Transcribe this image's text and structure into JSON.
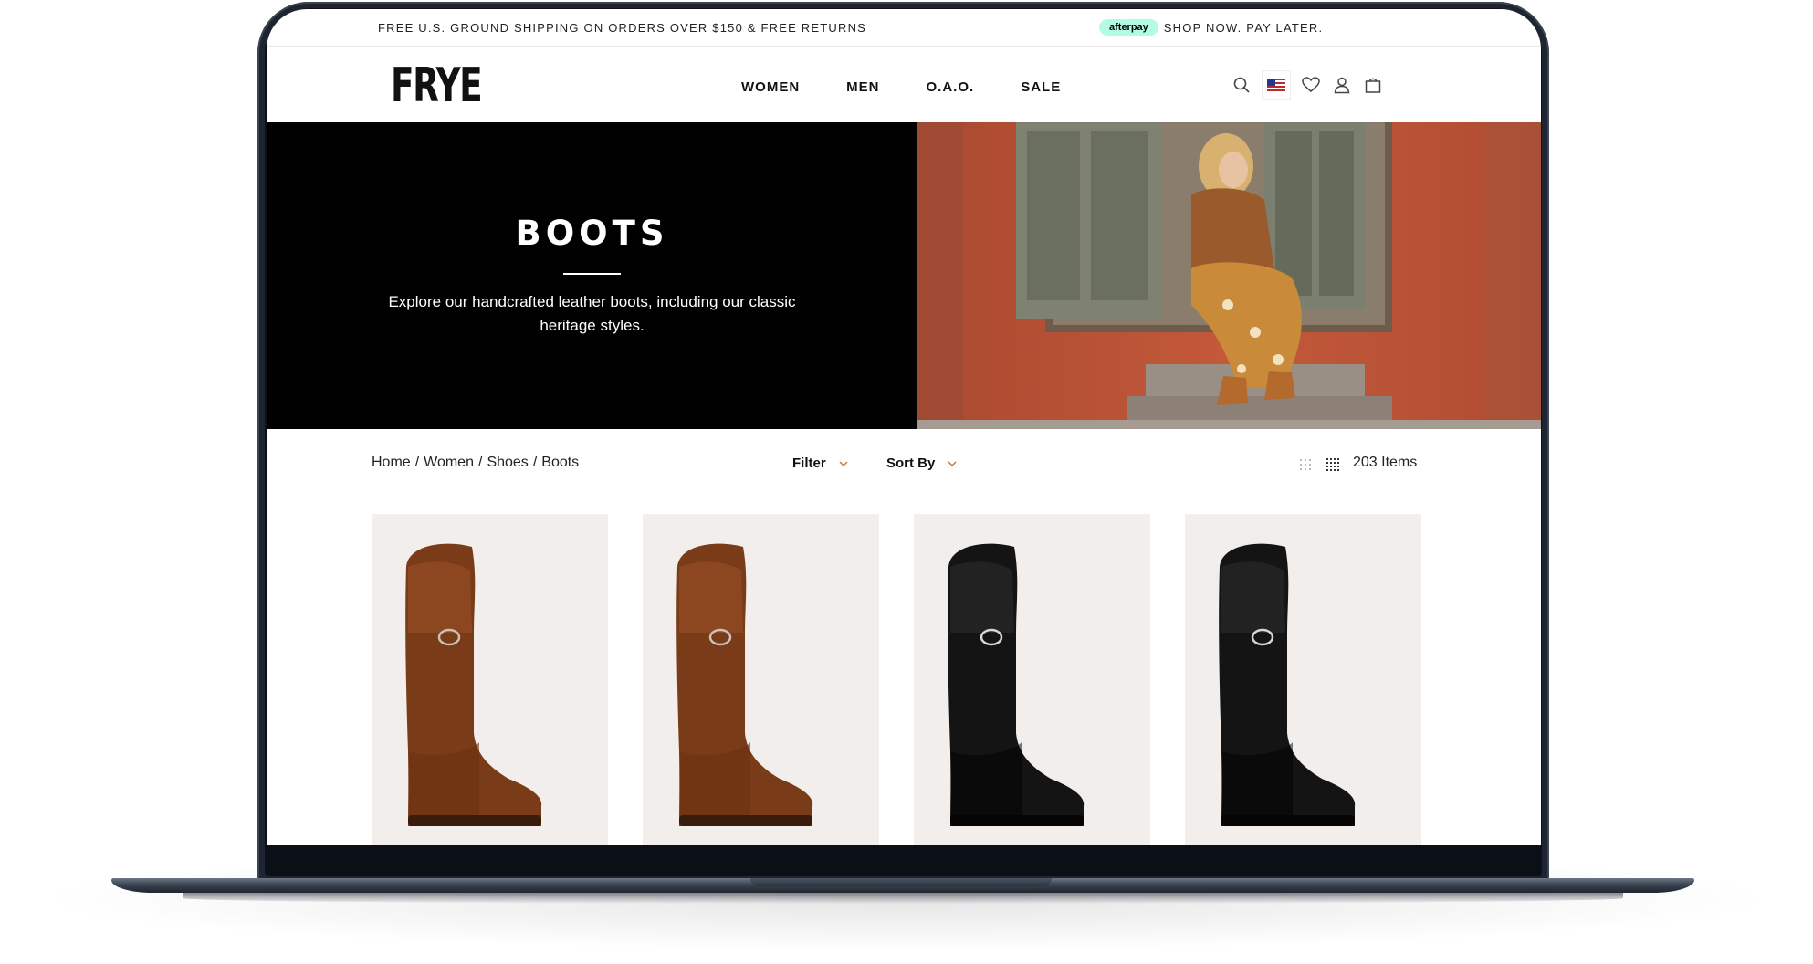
{
  "promo": {
    "shipping_text": "FREE U.S. GROUND SHIPPING ON ORDERS OVER $150 & FREE RETURNS",
    "afterpay_logo": "afterpay",
    "afterpay_text": "SHOP NOW. PAY LATER."
  },
  "header": {
    "logo": "FRYE",
    "nav": [
      {
        "label": "WOMEN"
      },
      {
        "label": "MEN"
      },
      {
        "label": "O.A.O."
      },
      {
        "label": "SALE"
      }
    ],
    "icons": [
      "search-icon",
      "us-flag-icon",
      "heart-icon",
      "user-icon",
      "bag-icon"
    ]
  },
  "hero": {
    "title": "BOOTS",
    "description": "Explore our handcrafted leather boots, including our classic heritage styles."
  },
  "toolbar": {
    "breadcrumb": [
      "Home",
      "Women",
      "Shoes",
      "Boots"
    ],
    "breadcrumb_separator": "/",
    "filter_label": "Filter",
    "sort_label": "Sort By",
    "item_count": "203 Items"
  },
  "products": [
    {
      "color": "brown"
    },
    {
      "color": "brown"
    },
    {
      "color": "black"
    },
    {
      "color": "black"
    }
  ],
  "colors": {
    "hero_bg": "#000000",
    "product_bg": "#f1eeeb",
    "afterpay": "#b2fce4",
    "chevron": "#c87a4a"
  }
}
